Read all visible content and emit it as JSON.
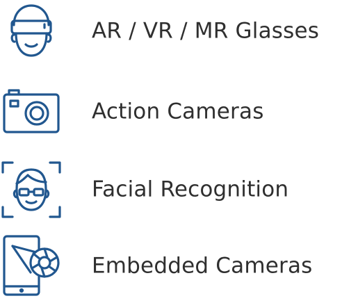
{
  "colors": {
    "icon": "#21578f",
    "text": "#2f2f2f"
  },
  "items": [
    {
      "label": "AR / VR / MR Glasses",
      "icon": "vr-headset-face-icon"
    },
    {
      "label": "Action Cameras",
      "icon": "camera-icon"
    },
    {
      "label": "Facial Recognition",
      "icon": "face-recognition-icon"
    },
    {
      "label": "Embedded Cameras",
      "icon": "tablet-camera-icon"
    }
  ]
}
